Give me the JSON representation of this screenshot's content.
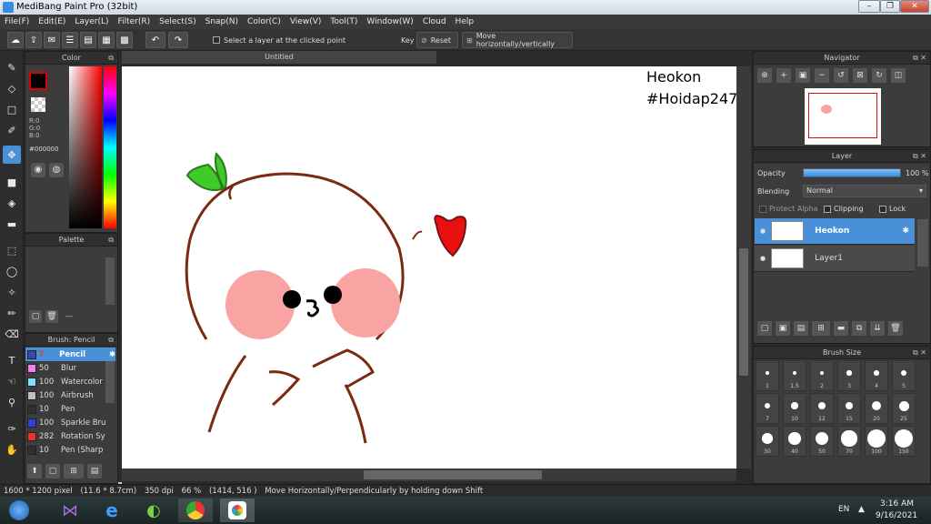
{
  "window": {
    "title": "MediBang Paint Pro (32bit)",
    "controls": [
      "–",
      "❐",
      "✕"
    ]
  },
  "menu": [
    "File(F)",
    "Edit(E)",
    "Layer(L)",
    "Filter(R)",
    "Select(S)",
    "Snap(N)",
    "Color(C)",
    "View(V)",
    "Tool(T)",
    "Window(W)",
    "Cloud",
    "Help"
  ],
  "toolbar": {
    "select_layer_label": "Select a layer at the clicked point",
    "key_label": "Key",
    "reset_label": "Reset",
    "move_hv_label": "Move horizontally/vertically"
  },
  "color_panel": {
    "title": "Color",
    "primary": "#000000",
    "secondary": "#ff6600",
    "r": "R:0",
    "g": "G:0",
    "b": "B:0",
    "hex": "#000000"
  },
  "palette_panel": {
    "title": "Palette",
    "colors": [
      "#ffffff",
      "#c0c0c0",
      "#80ff80",
      "#80ff00",
      "#00ff80",
      "#80ffff",
      "#8080ff",
      "#c0c0ff",
      "#ff8080",
      "#ffff00",
      "#00ff00",
      "#00ffff",
      "#0080ff",
      "#0000ff",
      "#ff00ff",
      "#ff0080",
      "#ff80c0",
      "#ffff80",
      "#ffc080",
      "#ff8000",
      "#ff0000",
      "#00c0c0",
      "#ff80ff",
      "#ffffff"
    ],
    "dash": "---"
  },
  "brush_panel": {
    "title": "Brush: Pencil",
    "items": [
      {
        "size": "7",
        "name": "Pencil",
        "color": "#3b4aa8",
        "selected": true
      },
      {
        "size": "50",
        "name": "Blur",
        "color": "#f080f0"
      },
      {
        "size": "100",
        "name": "Watercolor",
        "color": "#80e0ff"
      },
      {
        "size": "100",
        "name": "Airbrush",
        "color": "#c0c0c0"
      },
      {
        "size": "10",
        "name": "Pen",
        "color": "#303030"
      },
      {
        "size": "100",
        "name": "Sparkle Bru",
        "color": "#3040e0"
      },
      {
        "size": "282",
        "name": "Rotation Sy",
        "color": "#f03030"
      },
      {
        "size": "10",
        "name": "Pen (Sharp",
        "color": "#303030"
      }
    ]
  },
  "canvas": {
    "tab_title": "Untitled",
    "watermark_name": "Heokon",
    "watermark_tag": "#Hoidap247"
  },
  "navigator_panel": {
    "title": "Navigator"
  },
  "layer_panel": {
    "title": "Layer",
    "opacity_label": "Opacity",
    "opacity_value": "100 %",
    "opacity_fraction": 1.0,
    "blending_label": "Blending",
    "blending_value": "Normal",
    "protect_alpha_label": "Protect Alpha",
    "clipping_label": "Clipping",
    "lock_label": "Lock",
    "layers": [
      {
        "name": "Heokon",
        "selected": true
      },
      {
        "name": "Layer1",
        "selected": false
      }
    ]
  },
  "brush_size_panel": {
    "title": "Brush Size",
    "sizes": [
      "1",
      "1.5",
      "2",
      "3",
      "4",
      "5",
      "7",
      "10",
      "12",
      "15",
      "20",
      "25",
      "30",
      "40",
      "50",
      "70",
      "100",
      "150"
    ]
  },
  "status": {
    "size": "1600 * 1200 pixel",
    "physical": "(11.6 * 8.7cm)",
    "dpi": "350 dpi",
    "zoom": "66 %",
    "coords": "(1414, 516 )",
    "hint": "Move Horizontally/Perpendicularly by holding down Shift"
  },
  "taskbar": {
    "lang": "EN",
    "time": "3:16 AM",
    "date": "9/16/2021"
  }
}
